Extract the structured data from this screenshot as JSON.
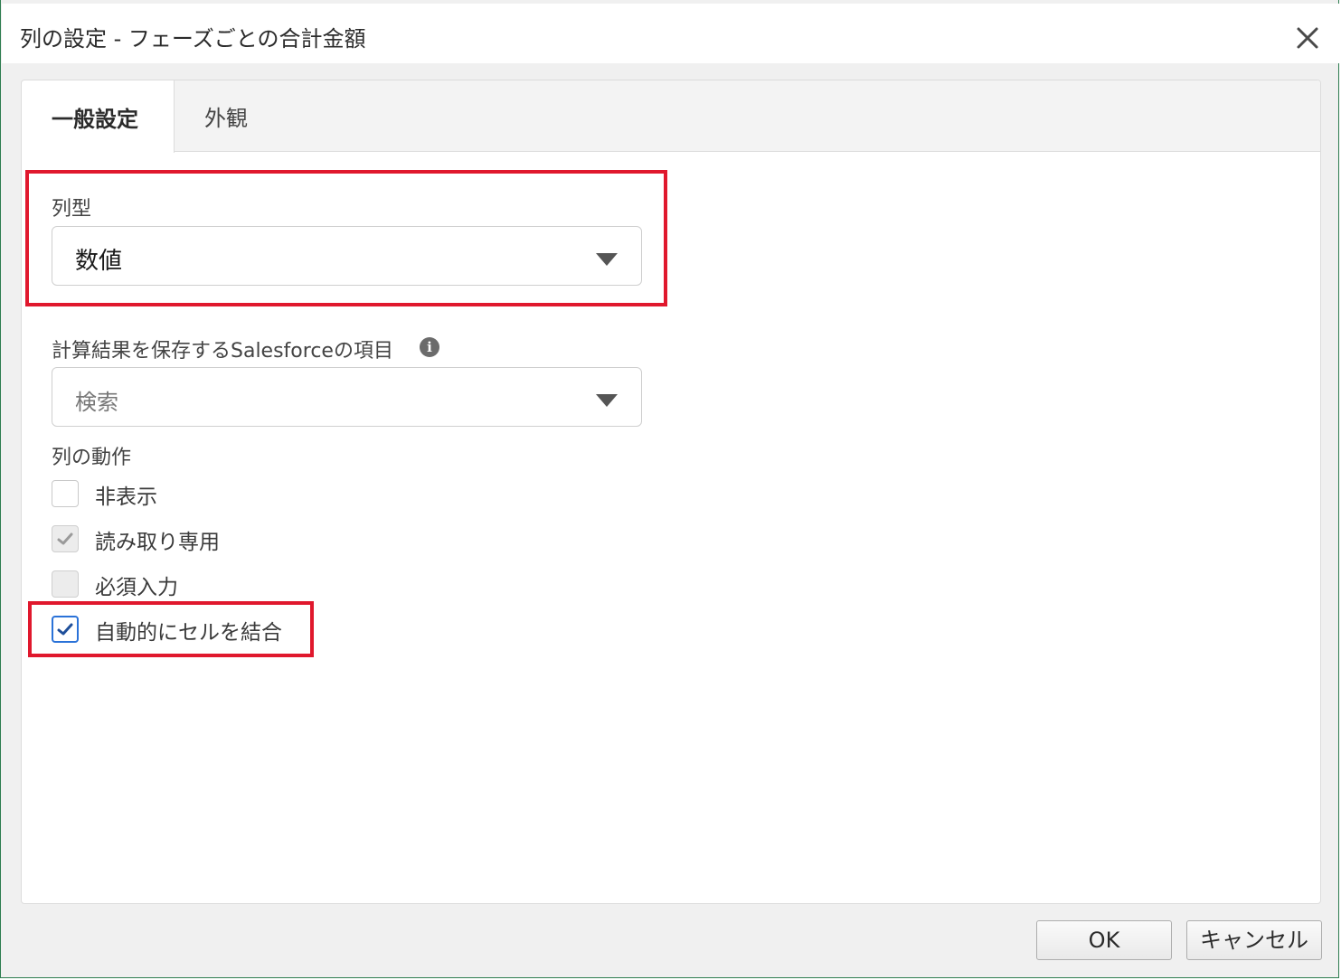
{
  "dialog": {
    "title": "列の設定 - フェーズごとの合計金額",
    "close_icon": "close-icon"
  },
  "tabs": [
    {
      "label": "一般設定",
      "active": true
    },
    {
      "label": "外観",
      "active": false
    }
  ],
  "column_type": {
    "label": "列型",
    "value": "数値"
  },
  "salesforce_field": {
    "label": "計算結果を保存するSalesforceの項目",
    "placeholder": "検索",
    "info_icon": "info-icon"
  },
  "column_behavior": {
    "label": "列の動作",
    "options": [
      {
        "label": "非表示",
        "checked": false,
        "disabled": false
      },
      {
        "label": "読み取り専用",
        "checked": true,
        "disabled": true
      },
      {
        "label": "必須入力",
        "checked": false,
        "disabled": true
      },
      {
        "label": "自動的にセルを結合",
        "checked": true,
        "disabled": false
      }
    ]
  },
  "buttons": {
    "ok": "OK",
    "cancel": "キャンセル"
  },
  "colors": {
    "highlight": "#e0182d",
    "checkbox_accent": "#2a72d8",
    "window_border": "#2e7d4f"
  }
}
